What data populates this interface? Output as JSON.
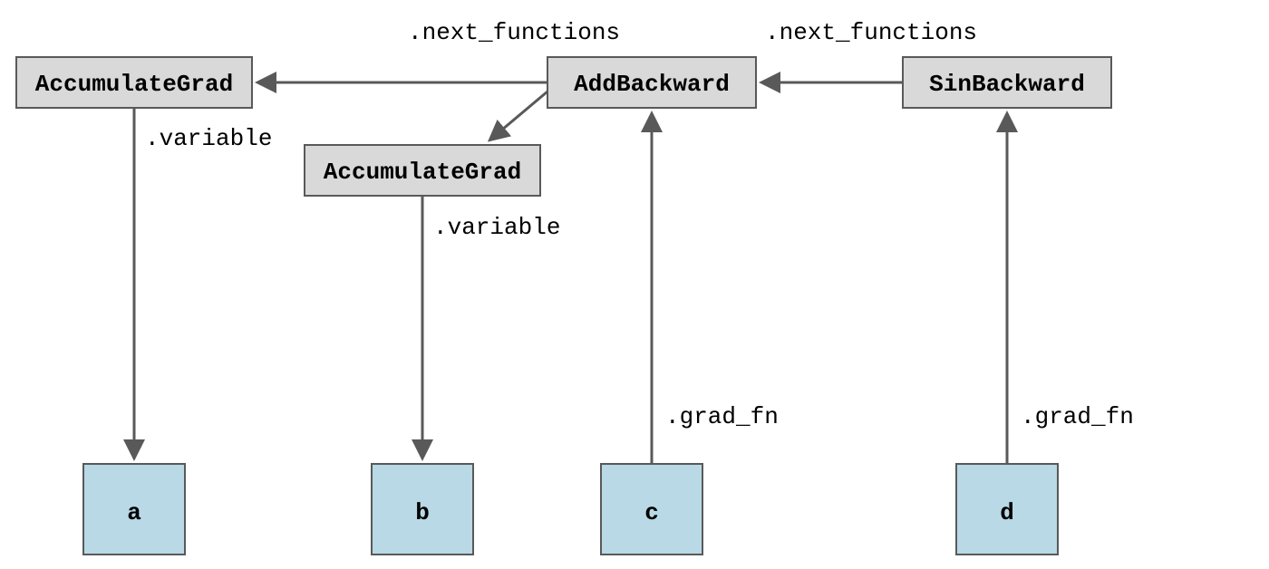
{
  "nodes": {
    "accgrad_a": {
      "label": "AccumulateGrad"
    },
    "accgrad_b": {
      "label": "AccumulateGrad"
    },
    "addback": {
      "label": "AddBackward"
    },
    "sinback": {
      "label": "SinBackward"
    },
    "var_a": {
      "label": "a"
    },
    "var_b": {
      "label": "b"
    },
    "var_c": {
      "label": "c"
    },
    "var_d": {
      "label": "d"
    }
  },
  "edge_labels": {
    "next_functions_1": ".next_functions",
    "next_functions_2": ".next_functions",
    "variable_a": ".variable",
    "variable_b": ".variable",
    "grad_fn_c": ".grad_fn",
    "grad_fn_d": ".grad_fn"
  },
  "colors": {
    "fn_fill": "#d9d9d9",
    "var_fill": "#b8d9e5",
    "stroke": "#595959"
  }
}
